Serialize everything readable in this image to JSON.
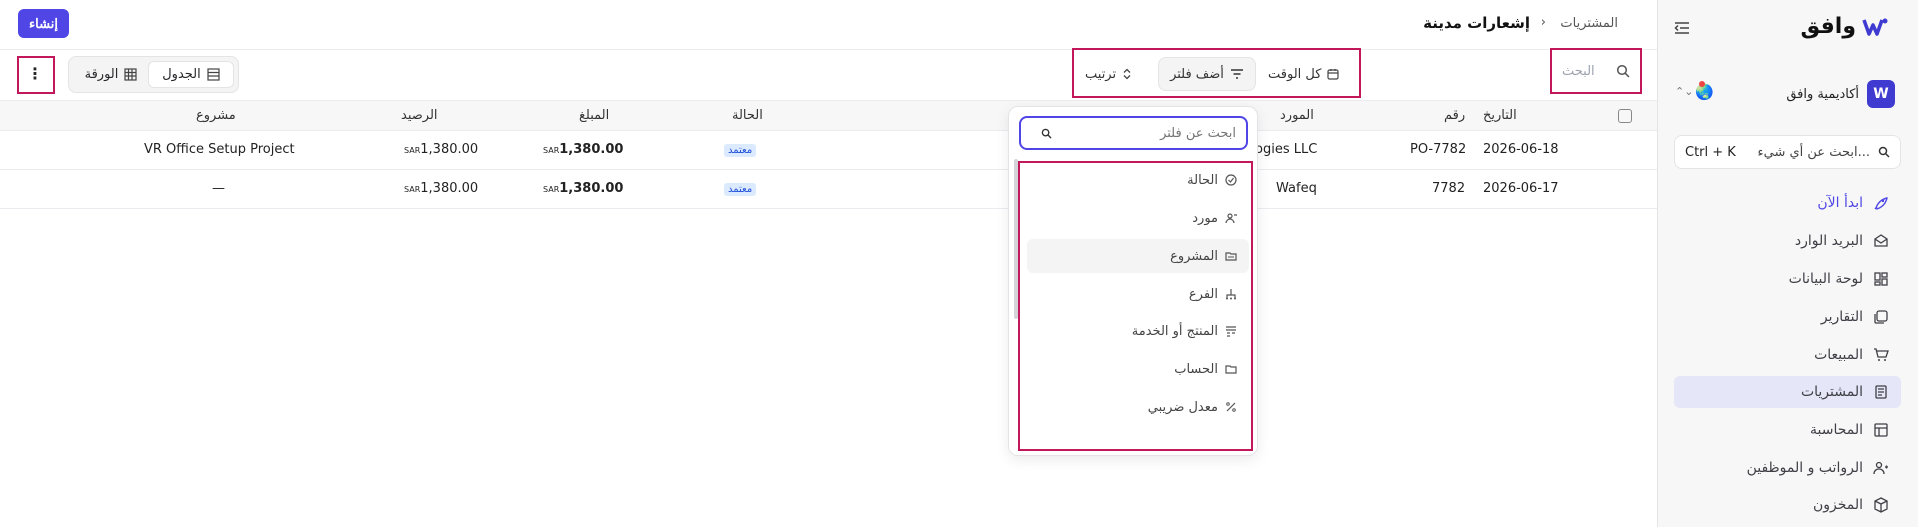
{
  "sidebar": {
    "brand": "وافق",
    "org_name": "أكاديمية وافق",
    "org_emoji": "🌏",
    "cmdk_placeholder": "ابحث عن أي شيء...",
    "cmdk_shortcut": "Ctrl + K",
    "items": [
      {
        "label": "ابدأ الآن",
        "icon": "rocket-icon"
      },
      {
        "label": "البريد الوارد",
        "icon": "inbox-icon"
      },
      {
        "label": "لوحة البيانات",
        "icon": "dashboard-icon"
      },
      {
        "label": "التقارير",
        "icon": "reports-icon"
      },
      {
        "label": "المبيعات",
        "icon": "cart-icon"
      },
      {
        "label": "المشتريات",
        "icon": "purchases-icon"
      },
      {
        "label": "المحاسبة",
        "icon": "accounting-icon"
      },
      {
        "label": "الرواتب و الموظفين",
        "icon": "users-icon"
      },
      {
        "label": "المخزون",
        "icon": "box-icon"
      }
    ]
  },
  "header": {
    "breadcrumb_parent": "المشتريات",
    "breadcrumb_sep": "›",
    "title": "إشعارات مدينة",
    "create_label": "إنشاء"
  },
  "toolbar": {
    "search_placeholder": "البحث",
    "time_label": "كل الوقت",
    "filter_label": "أضف فلتر",
    "sort_label": "ترتيب",
    "view_table": "الجدول",
    "view_sheet": "الورقة"
  },
  "table": {
    "headers": {
      "date": "التاريخ",
      "number": "رقم",
      "supplier": "المورد",
      "status": "الحالة",
      "amount": "المبلغ",
      "balance": "الرصيد",
      "project": "مشروع"
    },
    "currency": "SAR",
    "rows": [
      {
        "date": "2026-06-18",
        "number": "PO-7782",
        "supplier": "ogies LLC",
        "status": "معتمد",
        "amount": "1,380.00",
        "balance": "1,380.00",
        "project": "VR Office Setup Project"
      },
      {
        "date": "2026-06-17",
        "number": "7782",
        "supplier": "Wafeq",
        "status": "معتمد",
        "amount": "1,380.00",
        "balance": "1,380.00",
        "project": "—"
      }
    ]
  },
  "filter_dropdown": {
    "search_placeholder": "ابحث عن فلتر",
    "items": [
      {
        "label": "الحالة",
        "icon": "check-circle-icon"
      },
      {
        "label": "مورد",
        "icon": "user-icon"
      },
      {
        "label": "المشروع",
        "icon": "folder-icon"
      },
      {
        "label": "الفرع",
        "icon": "branch-icon"
      },
      {
        "label": "المنتج أو الخدمة",
        "icon": "product-icon"
      },
      {
        "label": "الحساب",
        "icon": "folder-open-icon"
      },
      {
        "label": "معدل ضريبي",
        "icon": "percent-icon"
      }
    ]
  },
  "colors": {
    "accent": "#4f46e5",
    "highlight": "#c2185b",
    "badge_bg": "#dbeafe",
    "badge_text": "#1d4ed8"
  }
}
